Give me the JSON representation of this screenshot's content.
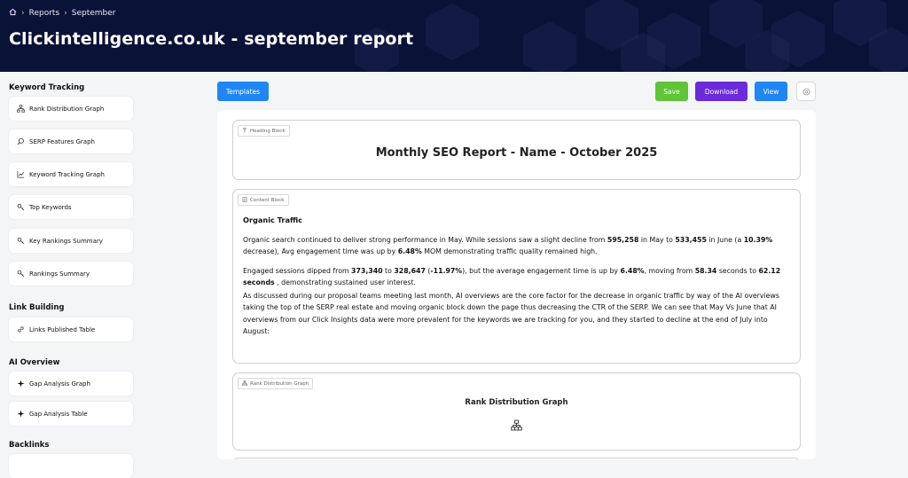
{
  "breadcrumb": {
    "home_icon": "home-icon",
    "items": [
      "Reports",
      "September"
    ]
  },
  "header": {
    "title": "Clickintelligence.co.uk - september report"
  },
  "sidebar": {
    "sections": [
      {
        "title": "Keyword Tracking",
        "items": [
          {
            "label": "Rank Distribution Graph",
            "icon": "sitemap-icon"
          },
          {
            "label": "SERP Features Graph",
            "icon": "search-doc-icon"
          },
          {
            "label": "Keyword Tracking Graph",
            "icon": "line-chart-icon"
          },
          {
            "label": "Top Keywords",
            "icon": "key-icon"
          },
          {
            "label": "Key Rankings Summary",
            "icon": "key-icon"
          },
          {
            "label": "Rankings Summary",
            "icon": "key-icon"
          }
        ]
      },
      {
        "title": "Link Building",
        "items": [
          {
            "label": "Links Published Table",
            "icon": "link-icon"
          }
        ]
      },
      {
        "title": "AI Overview",
        "items": [
          {
            "label": "Gap Analysis Graph",
            "icon": "sparkle-icon"
          },
          {
            "label": "Gap Analysis Table",
            "icon": "sparkle-icon"
          }
        ]
      },
      {
        "title": "Backlinks",
        "items": []
      }
    ]
  },
  "toolbar": {
    "templates": "Templates",
    "save": "Save",
    "download": "Download",
    "view": "View",
    "settings_icon": "gear-icon"
  },
  "blocks": {
    "heading": {
      "tag": "Heading Block",
      "text": "Monthly SEO Report - Name - October 2025"
    },
    "content": {
      "tag": "Content Block",
      "heading": "Organic Traffic",
      "p1": {
        "a": "Organic search continued to deliver strong performance in May. While sessions saw a slight decline from ",
        "b": "595,258",
        "c": " in May to ",
        "d": "533,455",
        "e": " in June (a ",
        "f": "10.39%",
        "g": " decrease), Avg engagement time was up by ",
        "h": "6.48%",
        "i": " MOM demonstrating traffic quality remained high."
      },
      "p2": {
        "a": "Engaged sessions dipped from ",
        "b": "373,340",
        "c": " to ",
        "d": "328,647",
        "e": " (",
        "f": "-11.97%",
        "g": "), but the average engagement time is up by ",
        "h": "6.48%",
        "i": ", moving from ",
        "j": "58.34",
        "k": " seconds to ",
        "l": "62.12 seconds",
        "m": " , demonstrating sustained user interest."
      },
      "p3": " As discussed during our proposal teams meeting last month, AI overviews are the core factor for the decrease in organic traffic by way of the AI overviews taking the top of the SERP real estate and moving organic block down the page thus decreasing the CTR of the SERP. We can see that May Vs June that AI overviews from our Click Insights data were more prevalent for the keywords we are tracking for you, and they started to decline at the end of July into August:"
    },
    "rank": {
      "tag": "Rank Distribution Graph",
      "title": "Rank Distribution Graph",
      "icon": "sitemap-icon"
    }
  }
}
